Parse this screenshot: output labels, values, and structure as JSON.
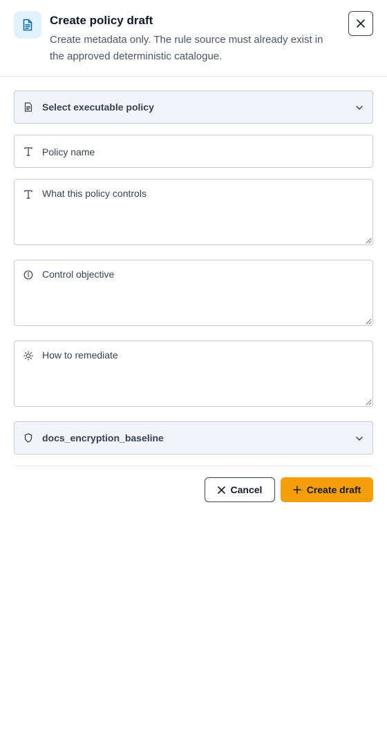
{
  "header": {
    "icon": "document-icon",
    "title": "Create policy draft",
    "subtitle": "Create metadata only. The rule source must already exist in the approved deterministic catalogue.",
    "close_icon": "close-icon"
  },
  "form": {
    "policy_select": {
      "icon": "document-icon",
      "label": "Select executable policy"
    },
    "policy_name": {
      "icon": "text-icon",
      "placeholder": "Policy name"
    },
    "description": {
      "icon": "text-icon",
      "placeholder": "What this policy controls"
    },
    "objective": {
      "icon": "info-icon",
      "placeholder": "Control objective"
    },
    "remediation": {
      "icon": "sun-icon",
      "placeholder": "How to remediate"
    },
    "rule_select": {
      "icon": "shield-icon",
      "value": "docs_encryption_baseline"
    }
  },
  "actions": {
    "cancel_label": "Cancel",
    "create_label": "Create draft"
  },
  "colors": {
    "accent": "#f59e0b",
    "header_icon_bg": "#e0f2fe",
    "header_icon": "#0369a1",
    "select_bg": "#f1f4f8"
  }
}
